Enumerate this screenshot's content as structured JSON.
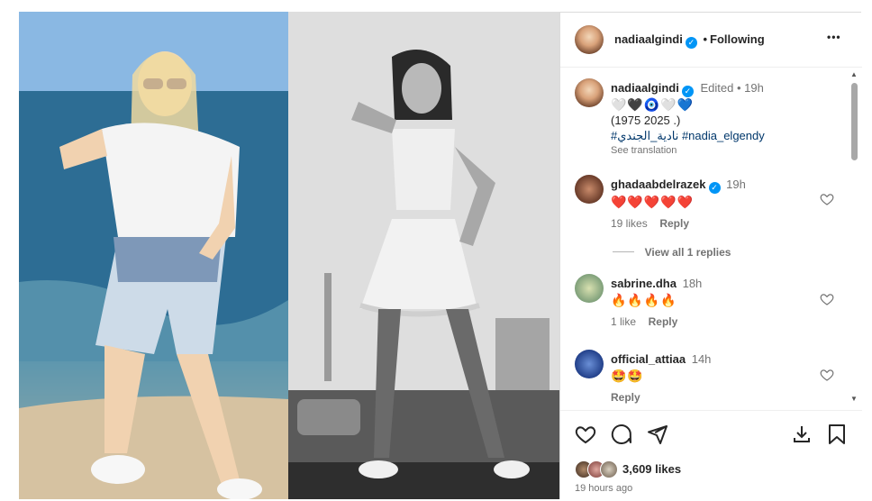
{
  "post": {
    "author": "nadiaalgindi",
    "verified": true,
    "follow_status": "Following",
    "more_label": "•••"
  },
  "caption": {
    "username": "nadiaalgindi",
    "edited": "Edited",
    "time": "19h",
    "emojis": "🤍🖤🧿🤍💙",
    "years": "(1975 2025 .)",
    "hashtag_ar": "#نادية_الجندي",
    "hashtag_en": "#nadia_elgendy",
    "see_translation": "See translation"
  },
  "comments": [
    {
      "username": "ghadaabdelrazek",
      "verified": true,
      "time": "19h",
      "text": "❤️❤️❤️❤️❤️",
      "likes": "19 likes",
      "reply": "Reply",
      "view_replies": "View all 1 replies"
    },
    {
      "username": "sabrine.dha",
      "verified": false,
      "time": "18h",
      "text": "🔥🔥🔥🔥",
      "likes": "1 like",
      "reply": "Reply"
    },
    {
      "username": "official_attiaa",
      "verified": false,
      "time": "14h",
      "text": "🤩🤩",
      "likes": "",
      "reply": "Reply"
    }
  ],
  "footer": {
    "likes": "3,609 likes",
    "timestamp": "19 hours ago"
  },
  "colors": {
    "verified_blue": "#0095f6",
    "text_primary": "#262626",
    "text_muted": "#737373",
    "hashtag": "#00376b"
  }
}
